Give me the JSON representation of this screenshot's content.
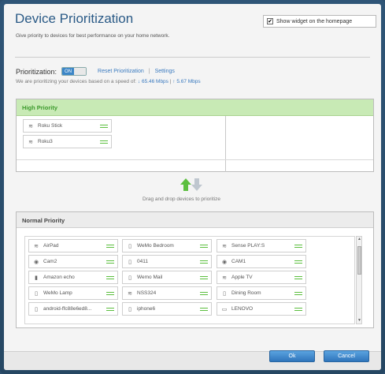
{
  "header": {
    "title": "Device Prioritization",
    "subtitle": "Give priority to devices for best performance on your home network.",
    "widget_checkbox_label": "Show widget on the homepage",
    "widget_checked": "✔"
  },
  "prioritization": {
    "label": "Prioritization:",
    "toggle_on": "ON",
    "reset_link": "Reset Prioritization",
    "pipe": "|",
    "settings_link": "Settings",
    "speed_prefix": "We are prioritizing your devices based on a speed of:",
    "download_speed": "65.46 Mbps",
    "speed_sep": "|",
    "upload_speed": "5.67 Mbps"
  },
  "high_priority": {
    "title": "High Priority",
    "devices": [
      {
        "name": "Roku Stick",
        "icon": "wifi-icon"
      },
      {
        "name": "Roku3",
        "icon": "wifi-icon"
      }
    ]
  },
  "drag_hint": "Drag and drop devices to prioritize",
  "normal_priority": {
    "title": "Normal Priority",
    "devices": [
      {
        "name": "AirPad",
        "icon": "wifi-icon"
      },
      {
        "name": "WeMo Bedroom",
        "icon": "plug-icon"
      },
      {
        "name": "Sense PLAY:S",
        "icon": "wifi-icon"
      },
      {
        "name": "Cam2",
        "icon": "camera-icon"
      },
      {
        "name": "0411",
        "icon": "plug-icon"
      },
      {
        "name": "CAM1",
        "icon": "camera-icon"
      },
      {
        "name": "Amazon echo",
        "icon": "speaker-icon"
      },
      {
        "name": "Wemo Mail",
        "icon": "plug-icon"
      },
      {
        "name": "Apple TV",
        "icon": "wifi-icon"
      },
      {
        "name": "WeMo Lamp",
        "icon": "plug-icon"
      },
      {
        "name": "NSS324",
        "icon": "wifi-icon"
      },
      {
        "name": "Dining Room",
        "icon": "plug-icon"
      },
      {
        "name": "android-ffc88e6ed8...",
        "icon": "phone-icon"
      },
      {
        "name": "iphone6",
        "icon": "phone-icon"
      },
      {
        "name": "LENOVO",
        "icon": "monitor-icon"
      }
    ]
  },
  "buttons": {
    "ok": "Ok",
    "cancel": "Cancel"
  },
  "colors": {
    "accent": "#3a7abf",
    "high_priority_header": "#c8eab5",
    "grip_green": "#5cbf3f"
  }
}
